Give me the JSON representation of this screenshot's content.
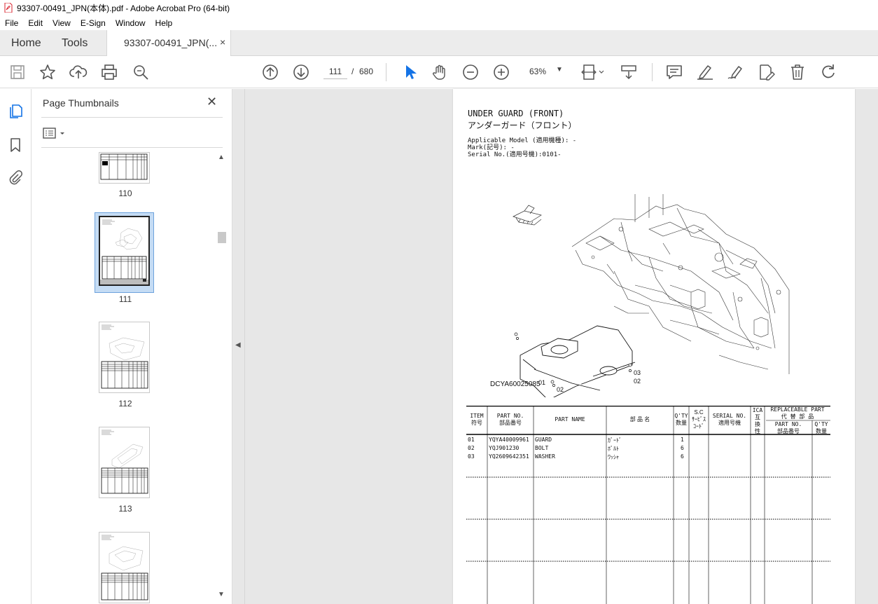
{
  "window": {
    "title": "93307-00491_JPN(本体).pdf - Adobe Acrobat Pro (64-bit)"
  },
  "menu": [
    "File",
    "Edit",
    "View",
    "E-Sign",
    "Window",
    "Help"
  ],
  "tabs": {
    "home": "Home",
    "tools": "Tools",
    "document": "93307-00491_JPN(...",
    "close_glyph": "×"
  },
  "toolbar": {
    "current_page": "111",
    "page_separator": "/",
    "total_pages": "680",
    "zoom": "63%"
  },
  "thumbnails": {
    "title": "Page Thumbnails",
    "close_glyph": "✕",
    "pages": [
      {
        "label": "110",
        "selected": false
      },
      {
        "label": "111",
        "selected": true
      },
      {
        "label": "112",
        "selected": false
      },
      {
        "label": "113",
        "selected": false
      },
      {
        "label": "",
        "selected": false
      }
    ]
  },
  "document": {
    "title_en": "UNDER GUARD (FRONT)",
    "title_jp": "アンダーガード（フロント）",
    "applicable_model": "Applicable Model (適用機種): -",
    "mark": "Mark(記号): -",
    "serial": "Serial No.(適用号機):0101-",
    "drawing_code": "DCYA60025085",
    "callouts": [
      "03",
      "02",
      "01",
      "02",
      "03",
      "02"
    ],
    "table": {
      "headers": {
        "item": "ITEM\n符号",
        "part_no": "PART NO.\n部品番号",
        "part_name": "PART NAME",
        "jp_name": "部 品 名",
        "qty": "Q'TY\n数量",
        "sc": "S.C\nｻｰﾋﾞｽ\nｺｰﾄﾞ",
        "serial_no": "SERIAL NO.\n適用号機",
        "ica": "ICA\n互\n換\n性",
        "replaceable": "REPLACEABLE PART\n代 替 部 品",
        "rep_part_no": "PART NO.\n部品番号",
        "rep_qty": "Q'TY\n数量"
      },
      "rows": [
        {
          "item": "01",
          "part_no": "YQYA40009961",
          "part_name": "GUARD",
          "jp_name": "ｶﾞｰﾄﾞ",
          "qty": "1"
        },
        {
          "item": "02",
          "part_no": "YQJ901230",
          "part_name": "BOLT",
          "jp_name": "ﾎﾞﾙﾄ",
          "qty": "6"
        },
        {
          "item": "03",
          "part_no": "YQ2609642351",
          "part_name": "WASHER",
          "jp_name": "ﾜｯｼｬ",
          "qty": "6"
        }
      ]
    }
  },
  "colors": {
    "accent_blue": "#1473e6",
    "acrobat_red": "#d9232e",
    "doc_background": "#e7e7e7",
    "selected_thumb_bg": "#c5dcf4"
  }
}
